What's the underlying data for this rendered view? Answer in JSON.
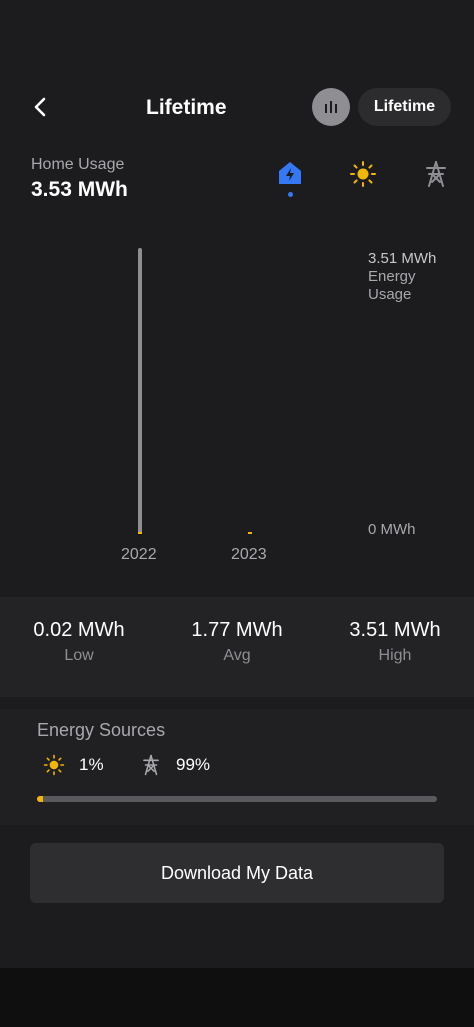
{
  "header": {
    "title": "Lifetime",
    "period_label": "Lifetime",
    "back_icon": "chevron-left-icon",
    "chart_toggle_icon": "bar-chart-icon"
  },
  "usage": {
    "label": "Home Usage",
    "value": "3.53 MWh"
  },
  "source_tabs": [
    {
      "icon": "home-lightning-icon",
      "selected": true,
      "color": "#3478f6"
    },
    {
      "icon": "sun-icon",
      "selected": false,
      "color": "#f2b705"
    },
    {
      "icon": "power-tower-icon",
      "selected": false,
      "color": "#8e8e93"
    }
  ],
  "chart_data": {
    "type": "bar",
    "categories": [
      "2022",
      "2023"
    ],
    "values": [
      3.51,
      0.02
    ],
    "units": "MWh",
    "ylim": [
      0,
      3.51
    ],
    "y_top_value": "3.51 MWh",
    "y_top_line1": "Energy",
    "y_top_line2": "Usage",
    "y_bottom_label": "0 MWh",
    "colors": {
      "grid": "#8e8e93",
      "solar": "#f2b705"
    }
  },
  "stats": [
    {
      "value": "0.02 MWh",
      "label": "Low"
    },
    {
      "value": "1.77 MWh",
      "label": "Avg"
    },
    {
      "value": "3.51 MWh",
      "label": "High"
    }
  ],
  "energy_sources": {
    "title": "Energy Sources",
    "solar": {
      "icon": "sun-icon",
      "percent": "1%"
    },
    "grid": {
      "icon": "power-tower-icon",
      "percent": "99%"
    },
    "solar_fraction": 0.01
  },
  "download_label": "Download My Data",
  "colors": {
    "background": "#1c1c1e",
    "accent_blue": "#3478f6",
    "solar_yellow": "#f2b705"
  }
}
